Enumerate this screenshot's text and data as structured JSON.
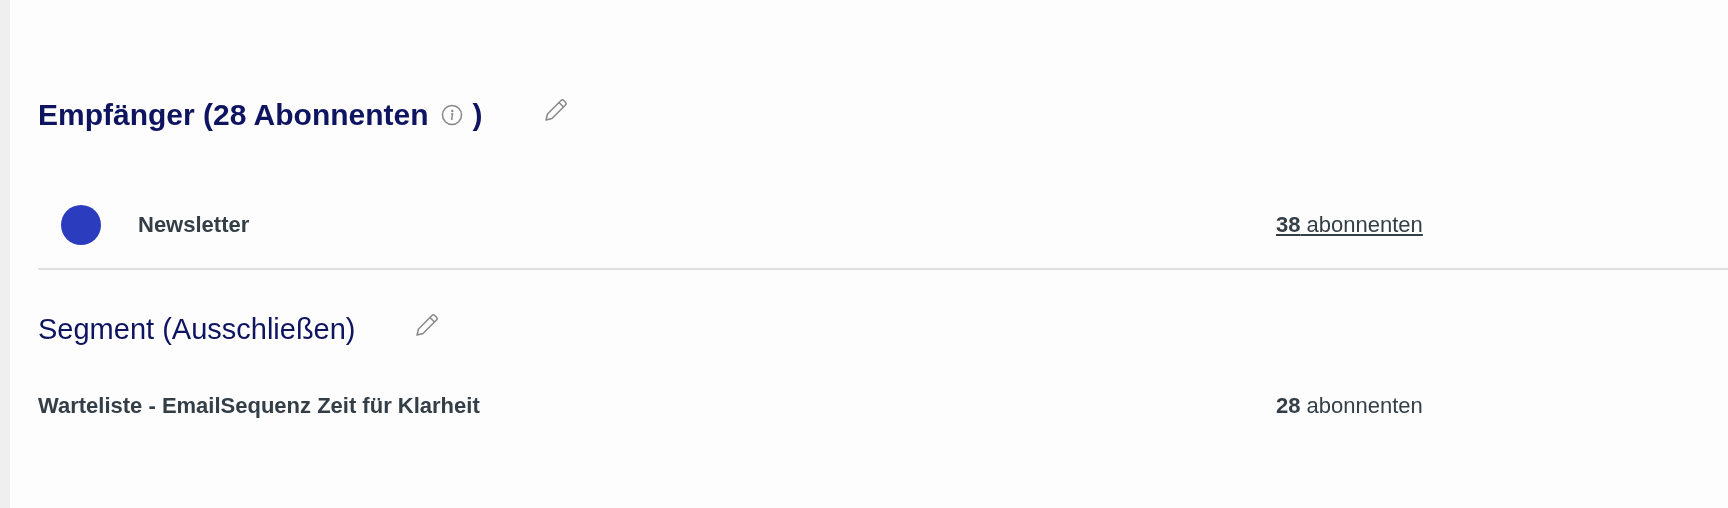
{
  "recipients": {
    "title": "Empfänger (28 Abonnenten",
    "title_end": ")",
    "items": [
      {
        "name": "Newsletter",
        "color": "#2b3cbf",
        "count": "**38** abonnenten",
        "linked": true
      }
    ]
  },
  "segment": {
    "title": "Segment (Ausschließen)",
    "items": [
      {
        "name": "Warteliste - EmailSequenz Zeit für Klarheit",
        "count": "**28** abonnenten",
        "linked": false
      }
    ]
  }
}
